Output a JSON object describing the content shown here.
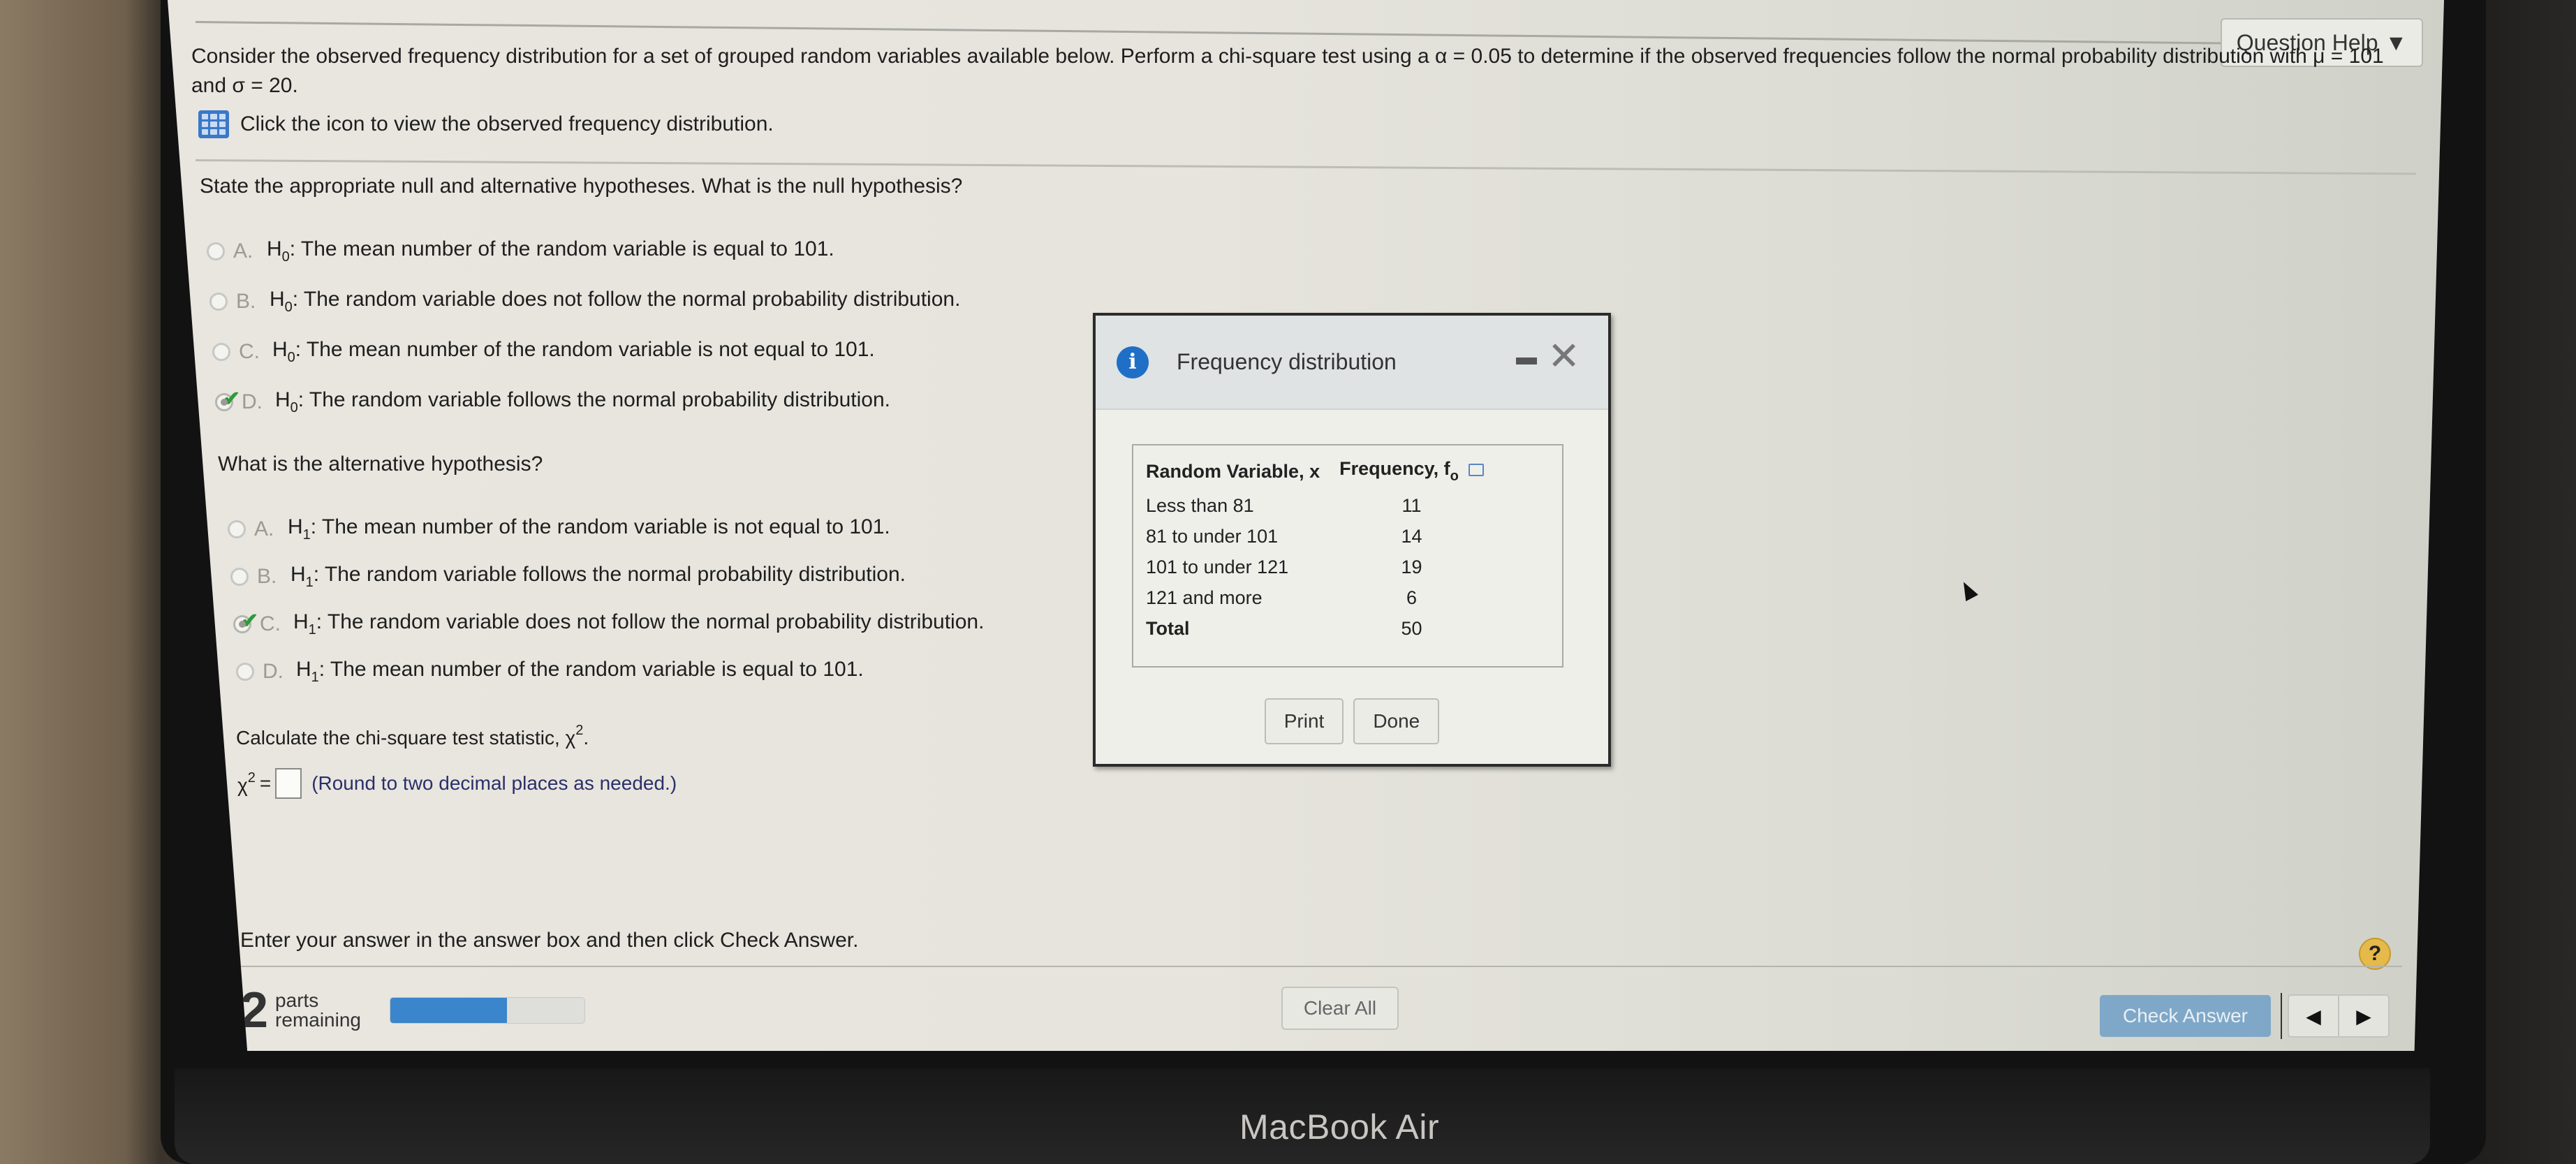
{
  "header": {
    "question_help_label": "Question Help",
    "question_help_icon": "dropdown-arrow-icon",
    "settings_icon": "gear-icon"
  },
  "question": {
    "text": "Consider the observed frequency distribution for a set of grouped random variables available below. Perform a chi-square test using a α = 0.05 to determine if the observed frequencies follow the normal probability distribution with μ = 101 and σ = 20.",
    "view_link_icon": "table-grid-icon",
    "view_link_text": "Click the icon to view the observed frequency distribution."
  },
  "part1": {
    "prompt": "State the appropriate null and alternative hypotheses. What is the null hypothesis?",
    "options": [
      {
        "letter": "A.",
        "hyp": "H",
        "sub": "0",
        "text": ": The mean number of the random variable is equal to 101.",
        "selected": false
      },
      {
        "letter": "B.",
        "hyp": "H",
        "sub": "0",
        "text": ": The random variable does not follow the normal probability distribution.",
        "selected": false
      },
      {
        "letter": "C.",
        "hyp": "H",
        "sub": "0",
        "text": ": The mean number of the random variable is not equal to 101.",
        "selected": false
      },
      {
        "letter": "D.",
        "hyp": "H",
        "sub": "0",
        "text": ": The random variable follows the normal probability distribution.",
        "selected": true,
        "correct": true
      }
    ]
  },
  "part2": {
    "prompt": "What is the alternative hypothesis?",
    "options": [
      {
        "letter": "A.",
        "hyp": "H",
        "sub": "1",
        "text": ": The mean number of the random variable is not equal to 101.",
        "selected": false
      },
      {
        "letter": "B.",
        "hyp": "H",
        "sub": "1",
        "text": ": The random variable follows the normal probability distribution.",
        "selected": false
      },
      {
        "letter": "C.",
        "hyp": "H",
        "sub": "1",
        "text": ": The random variable does not follow the normal probability distribution.",
        "selected": true,
        "correct": true
      },
      {
        "letter": "D.",
        "hyp": "H",
        "sub": "1",
        "text": ": The mean number of the random variable is equal to 101.",
        "selected": false
      }
    ]
  },
  "part3": {
    "prompt_prefix": "Calculate the chi-square test statistic, χ",
    "prompt_sup": "2",
    "prompt_suffix": ".",
    "answer_label": "χ",
    "answer_sup": "2",
    "answer_eq": "=",
    "answer_value": "",
    "hint": "(Round to two decimal places as needed.)"
  },
  "footer": {
    "instruction": "Enter your answer in the answer box and then click Check Answer.",
    "parts_remaining_count": "2",
    "parts_label_1": "parts",
    "parts_label_2": "remaining",
    "progress_fraction": 0.6,
    "clear_all_label": "Clear All",
    "check_answer_label": "Check Answer",
    "help_icon_label": "?",
    "prev_icon": "◀",
    "next_icon": "▶"
  },
  "dialog": {
    "title": "Frequency distribution",
    "info_icon_label": "i",
    "minimize_icon": "minimize-icon",
    "close_icon": "✕",
    "table": {
      "col1_header": "Random Variable, x",
      "col2_header": "Frequency, f",
      "col2_sub": "o",
      "rows": [
        {
          "x": "Less than 81",
          "f": "11"
        },
        {
          "x": "81 to under 101",
          "f": "14"
        },
        {
          "x": "101 to under 121",
          "f": "19"
        },
        {
          "x": "121 and more",
          "f": "6"
        }
      ],
      "total_label": "Total",
      "total_value": "50"
    },
    "print_label": "Print",
    "done_label": "Done"
  },
  "device": {
    "label": "MacBook Air"
  },
  "colors": {
    "accent_blue": "#3a85cc",
    "check_answer_bg": "#7fa8c8",
    "correct_green": "#2f9a3a",
    "help_gold": "#e5b94a"
  }
}
